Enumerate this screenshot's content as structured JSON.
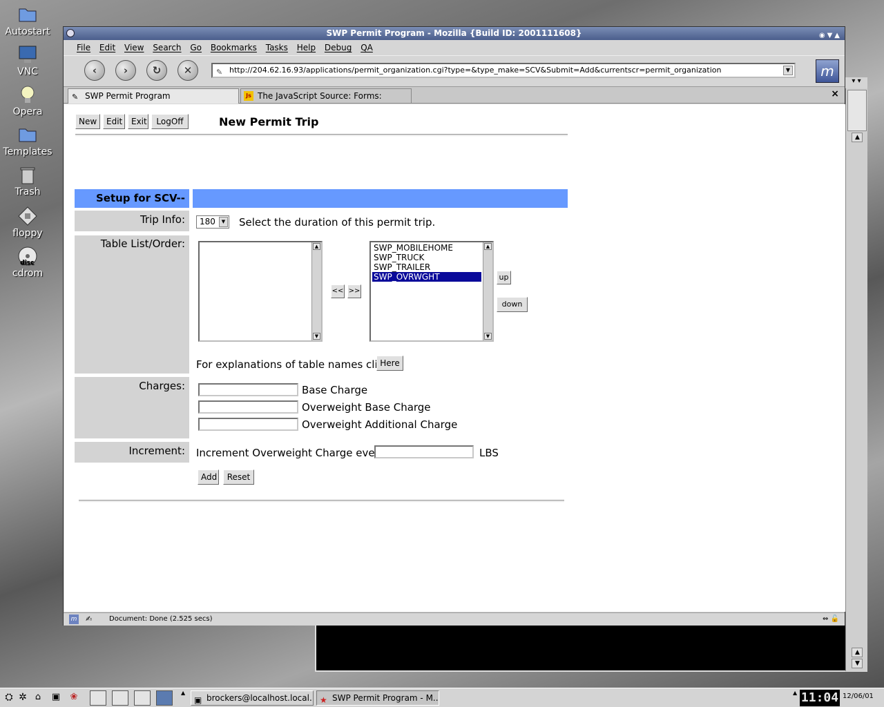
{
  "desktop": {
    "icons": [
      {
        "label": "Autostart",
        "icon": "folder-icon"
      },
      {
        "label": "VNC",
        "icon": "monitor-icon"
      },
      {
        "label": "Opera",
        "icon": "lightbulb-icon"
      },
      {
        "label": "Templates",
        "icon": "folder-icon"
      },
      {
        "label": "Trash",
        "icon": "trash-icon"
      },
      {
        "label": "floppy",
        "icon": "floppy-icon"
      },
      {
        "label": "cdrom",
        "icon": "cdrom-icon"
      }
    ],
    "cdrom_disc_label": "disc"
  },
  "window": {
    "title": "SWP Permit Program - Mozilla {Build ID: 2001111608}"
  },
  "menu": {
    "file": "File",
    "edit": "Edit",
    "view": "View",
    "search": "Search",
    "go": "Go",
    "bookmarks": "Bookmarks",
    "tasks": "Tasks",
    "help": "Help",
    "debug": "Debug",
    "qa": "QA"
  },
  "nav": {
    "url": "http://204.62.16.93/applications/permit_organization.cgi?type=&type_make=SCV&Submit=Add&currentscr=permit_organization",
    "logo": "m"
  },
  "tabs": [
    {
      "label": "SWP Permit Program"
    },
    {
      "label": "The JavaScript Source: Forms: Select..."
    }
  ],
  "tab_js_badge": "Js",
  "page": {
    "buttons": {
      "new": "New",
      "edit": "Edit",
      "exit": "Exit",
      "logoff": "LogOff"
    },
    "heading": "New Permit Trip",
    "setup_header": "Setup for SCV--",
    "trip_info": {
      "label": "Trip Info:",
      "select_value": "180",
      "description": "Select the duration of this permit trip."
    },
    "table_list": {
      "label": "Table List/Order:",
      "left_items": [],
      "right_items": [
        "SWP_MOBILEHOME",
        "SWP_TRUCK",
        "SWP_TRAILER",
        "SWP_OVRWGHT"
      ],
      "selected_item": "SWP_OVRWGHT",
      "move_left": "<<",
      "move_right": ">>",
      "up": "up",
      "down": "down",
      "explain_text": "For explanations of table names click",
      "here": "Here"
    },
    "charges": {
      "label": "Charges:",
      "fields": [
        {
          "label": "Base Charge",
          "value": ""
        },
        {
          "label": "Overweight Base Charge",
          "value": ""
        },
        {
          "label": "Overweight Additional Charge",
          "value": ""
        }
      ]
    },
    "increment": {
      "label": "Increment:",
      "text": "Increment Overweight Charge every",
      "value": "",
      "unit": "LBS"
    },
    "add": "Add",
    "reset": "Reset"
  },
  "status": {
    "text": "Document: Done (2.525 secs)"
  },
  "taskbar": {
    "tasks": [
      {
        "label": "brockers@localhost.local..."
      },
      {
        "label": "SWP Permit Program - M..."
      }
    ],
    "clock": "11:04",
    "date": "12/06/01"
  },
  "colors": {
    "setup_header": "#6699ff",
    "label_bg": "#d3d3d3",
    "selection": "#0a0a9a"
  }
}
